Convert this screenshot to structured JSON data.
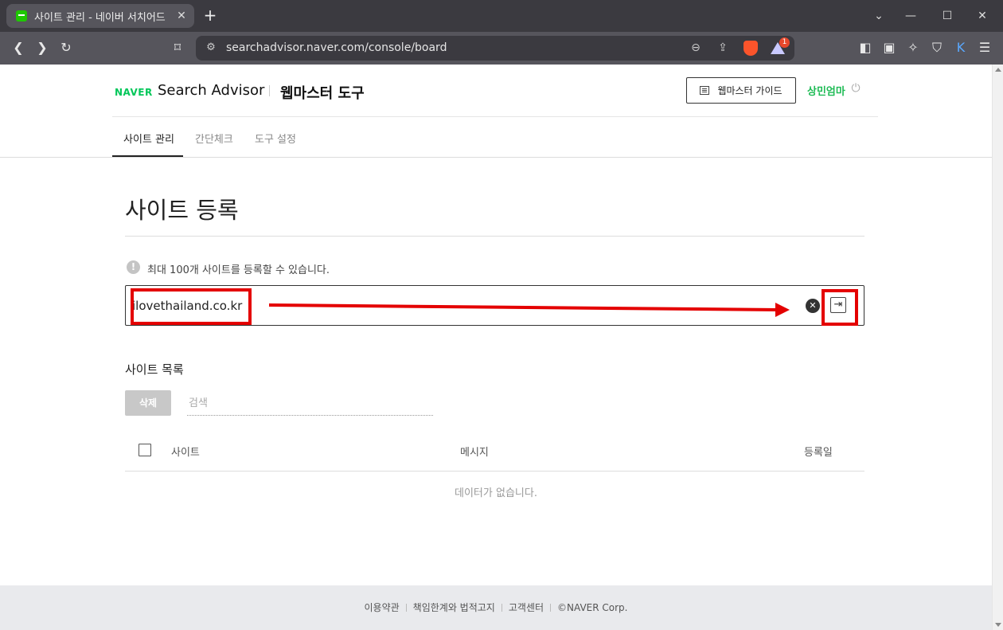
{
  "browser": {
    "tab_title": "사이트 관리 - 네이버 서치어드",
    "url": "searchadvisor.naver.com/console/board",
    "reward_badge": "1"
  },
  "header": {
    "brand_naver": "NAVER",
    "brand_product": "Search Advisor",
    "brand_tool": "웹마스터 도구",
    "guide_label": "웹마스터 가이드",
    "user_name": "상민엄마"
  },
  "nav": {
    "tabs": [
      {
        "label": "사이트 관리",
        "active": true
      },
      {
        "label": "간단체크",
        "active": false
      },
      {
        "label": "도구 설정",
        "active": false
      }
    ]
  },
  "register": {
    "title": "사이트 등록",
    "info": "최대 100개 사이트를 등록할 수 있습니다.",
    "input_value": "ilovethailand.co.kr"
  },
  "site_list": {
    "title": "사이트 목록",
    "delete_label": "삭제",
    "search_placeholder": "검색",
    "columns": [
      "사이트",
      "메시지",
      "등록일"
    ],
    "empty_message": "데이터가 없습니다."
  },
  "footer": {
    "links": [
      "이용약관",
      "책임한계와 법적고지",
      "고객센터",
      "©NAVER Corp."
    ]
  },
  "colors": {
    "annotation": "#e40000",
    "naver_green": "#03c75a"
  }
}
